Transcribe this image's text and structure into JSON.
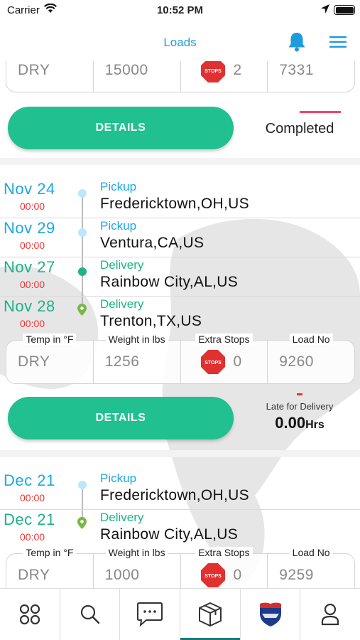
{
  "status_bar": {
    "carrier": "Carrier",
    "time": "10:52 PM"
  },
  "nav": {
    "title": "Loads",
    "icons": [
      "bell-icon",
      "hamburger-menu-icon"
    ]
  },
  "colors": {
    "accent": "#1e9bdc",
    "button": "#20c090",
    "date_blue": "#1aa9e0",
    "date_green": "#1cb387",
    "time_red": "#e33333",
    "completed_bar": "#ef476f"
  },
  "top_card": {
    "temp": "DRY",
    "weight": "15000",
    "stops": "2",
    "load_no": "7331",
    "details_label": "DETAILS",
    "status": "Completed"
  },
  "cards": [
    {
      "stops": [
        {
          "date": "Nov 24",
          "time": "00:00",
          "type": "Pickup",
          "location": "Fredericktown,OH,US"
        },
        {
          "date": "Nov 29",
          "time": "00:00",
          "type": "Pickup",
          "location": "Ventura,CA,US"
        },
        {
          "date": "Nov 27",
          "time": "00:00",
          "type": "Delivery",
          "location": "Rainbow City,AL,US"
        },
        {
          "date": "Nov 28",
          "time": "00:00",
          "type": "Delivery",
          "location": "Trenton,TX,US"
        }
      ],
      "info": {
        "temp_label": "Temp in °F",
        "temp": "DRY",
        "weight_label": "Weight in lbs",
        "weight": "1256",
        "stops_label": "Extra Stops",
        "stops": "0",
        "stop_sign": "STOPS",
        "load_label": "Load No",
        "load_no": "9260"
      },
      "details_label": "DETAILS",
      "late_label": "Late for Delivery",
      "late_value": "0.00",
      "late_unit": "Hrs"
    },
    {
      "stops": [
        {
          "date": "Dec 21",
          "time": "00:00",
          "type": "Pickup",
          "location": "Fredericktown,OH,US"
        },
        {
          "date": "Dec 21",
          "time": "00:00",
          "type": "Delivery",
          "location": "Rainbow City,AL,US"
        }
      ],
      "info": {
        "temp_label": "Temp in °F",
        "temp": "DRY",
        "weight_label": "Weight in lbs",
        "weight": "1000",
        "stops_label": "Extra Stops",
        "stops": "0",
        "stop_sign": "STOPS",
        "load_label": "Load No",
        "load_no": "9259"
      }
    }
  ],
  "tabbar": {
    "tabs": [
      "grid-icon",
      "search-icon",
      "chat-icon",
      "package-icon",
      "interstate-shield-icon",
      "profile-icon"
    ],
    "active_tab": "package-icon"
  }
}
